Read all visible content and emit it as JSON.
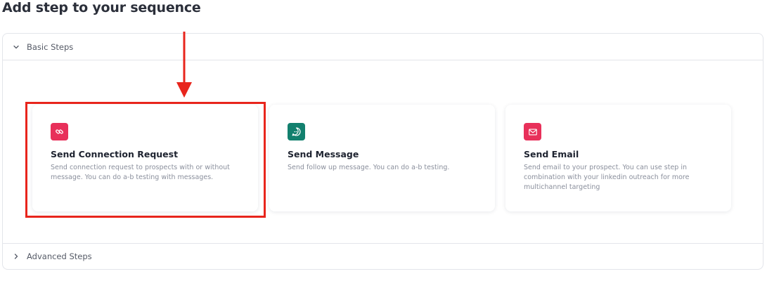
{
  "page_title": "Add step to your sequence",
  "sections": {
    "basic": {
      "label": "Basic Steps",
      "expanded": true
    },
    "advanced": {
      "label": "Advanced Steps",
      "expanded": false
    }
  },
  "cards": [
    {
      "title": "Send Connection Request",
      "description": "Send connection request to prospects with or without message. You can do a-b testing with messages.",
      "icon": "link-icon",
      "icon_color": "#e8305a",
      "highlighted": true
    },
    {
      "title": "Send Message",
      "description": "Send follow up message. You can do a-b testing.",
      "icon": "chat-bubble-icon",
      "icon_color": "#12806e",
      "highlighted": false
    },
    {
      "title": "Send Email",
      "description": "Send email to your prospect. You can use step in combination with your linkedin outreach for more multichannel targeting",
      "icon": "envelope-icon",
      "icon_color": "#e8305a",
      "highlighted": false
    }
  ],
  "annotation": {
    "color": "#e8251c"
  }
}
